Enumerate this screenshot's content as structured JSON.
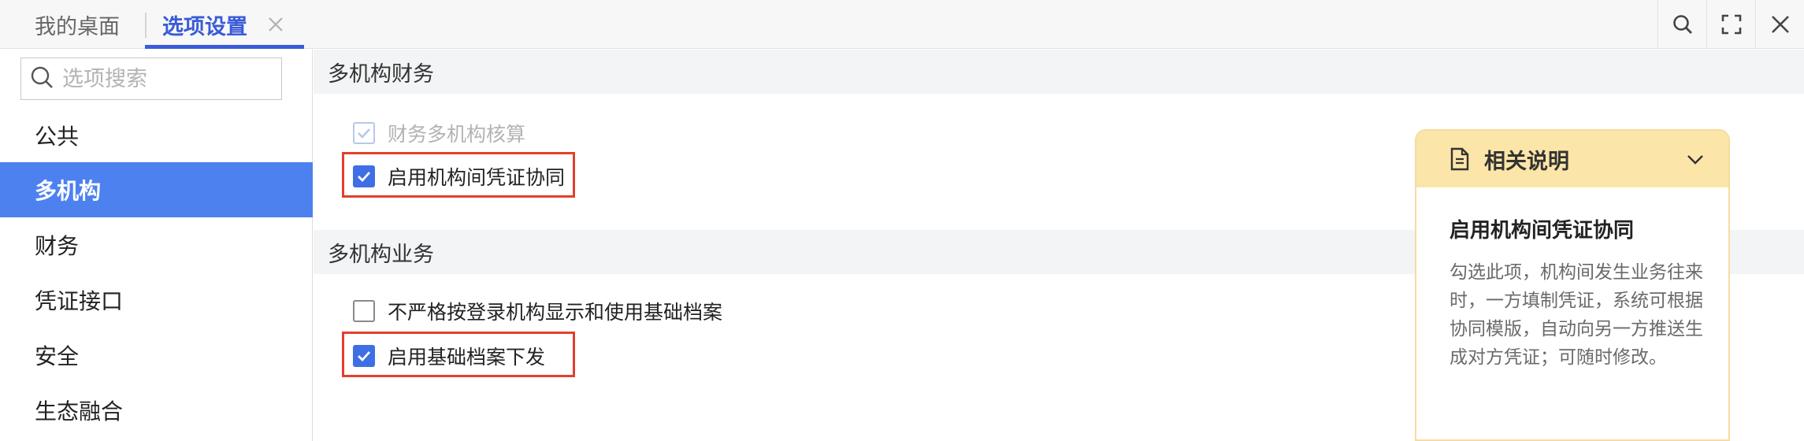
{
  "tabs": {
    "home": "我的桌面",
    "active": "选项设置"
  },
  "search": {
    "placeholder": "选项搜索"
  },
  "sidebar": {
    "items": [
      {
        "label": "公共"
      },
      {
        "label": "多机构",
        "active": true
      },
      {
        "label": "财务"
      },
      {
        "label": "凭证接口"
      },
      {
        "label": "安全"
      },
      {
        "label": "生态融合"
      }
    ]
  },
  "sections": [
    {
      "title": "多机构财务",
      "options": [
        {
          "label": "财务多机构核算",
          "checked": true,
          "disabled": true
        },
        {
          "label": "启用机构间凭证协同",
          "checked": true,
          "highlighted": true
        }
      ]
    },
    {
      "title": "多机构业务",
      "options": [
        {
          "label": "不严格按登录机构显示和使用基础档案",
          "checked": false
        },
        {
          "label": "启用基础档案下发",
          "checked": true,
          "highlighted": true
        }
      ]
    }
  ],
  "help": {
    "header": "相关说明",
    "title": "启用机构间凭证协同",
    "body": "勾选此项，机构间发生业务往来时，一方填制凭证，系统可根据协同模版，自动向另一方推送生成对方凭证；可随时修改。"
  },
  "icons": {
    "search": "search-icon",
    "fullscreen": "fullscreen-icon",
    "close": "close-icon",
    "document": "document-icon",
    "chevron": "chevron-down-icon"
  },
  "colors": {
    "accent": "#3a5bd8",
    "nav_active": "#4d81f0",
    "checkbox": "#3f6fe4",
    "highlight": "#e2402c",
    "help_header": "#fbe5a8"
  }
}
